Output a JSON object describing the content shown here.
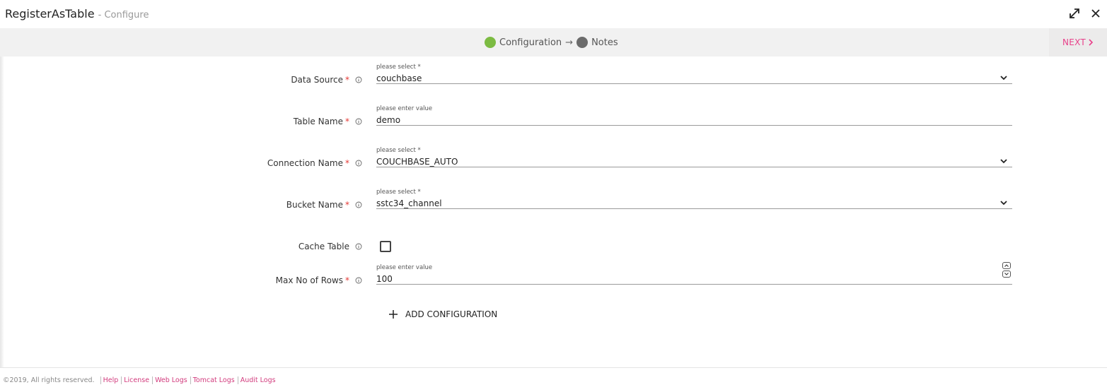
{
  "header": {
    "title": "RegisterAsTable",
    "subtitle": "- Configure",
    "expand_icon": "expand-icon",
    "close_icon": "close-icon"
  },
  "stepper": {
    "steps": [
      {
        "label": "Configuration",
        "status": "complete",
        "color": "#7cbb42"
      },
      {
        "label": "Notes",
        "status": "pending",
        "color": "#6b6b6b"
      }
    ],
    "separator": "→",
    "next_label": "NEXT",
    "accent": "#e8408a"
  },
  "form": {
    "data_source": {
      "label": "Data Source",
      "required": "*",
      "hint": "please select *",
      "value": "couchbase"
    },
    "table_name": {
      "label": "Table Name",
      "required": "*",
      "hint": "please enter value",
      "value": "demo"
    },
    "connection_name": {
      "label": "Connection Name",
      "required": "*",
      "hint": "please select *",
      "value": "COUCHBASE_AUTO"
    },
    "bucket_name": {
      "label": "Bucket Name",
      "required": "*",
      "hint": "please select *",
      "value": "sstc34_channel"
    },
    "cache_table": {
      "label": "Cache Table",
      "checked": false
    },
    "max_rows": {
      "label": "Max No of Rows",
      "required": "*",
      "hint": "please enter value",
      "value": "100"
    },
    "add_config_label": "ADD CONFIGURATION"
  },
  "footer": {
    "copyright": "©2019, All rights reserved.",
    "links": [
      "Help",
      "License",
      "Web Logs",
      "Tomcat Logs",
      "Audit Logs"
    ]
  }
}
